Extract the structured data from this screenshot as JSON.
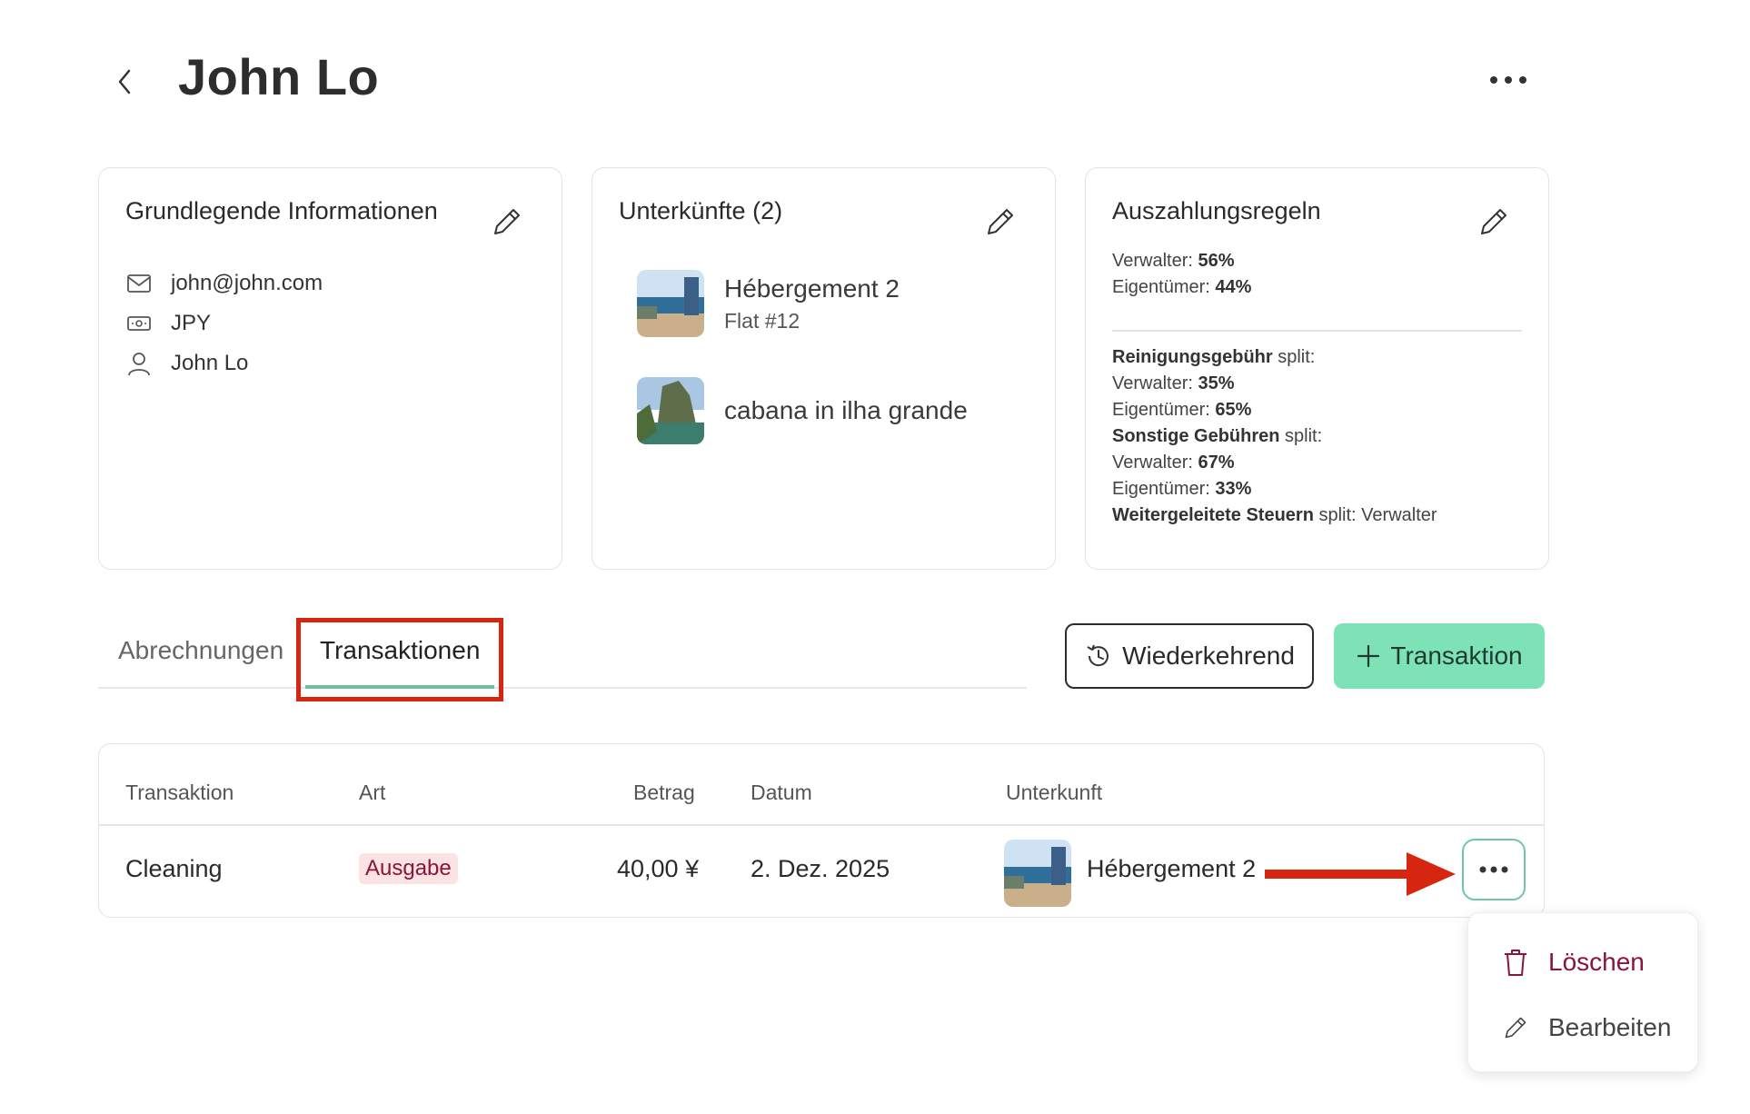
{
  "header": {
    "title": "John Lo"
  },
  "cards": {
    "basic": {
      "title": "Grundlegende Informationen",
      "email": "john@john.com",
      "currency": "JPY",
      "name": "John Lo"
    },
    "properties": {
      "title": "Unterkünfte (2)",
      "items": [
        {
          "name": "Hébergement 2",
          "sub": "Flat #12"
        },
        {
          "name": "cabana in ilha grande"
        }
      ]
    },
    "payout": {
      "title": "Auszahlungsregeln",
      "manager_label": "Verwalter: ",
      "manager_value": "56%",
      "owner_label": "Eigentümer: ",
      "owner_value": "44%",
      "cleaning_label": "Reinigungsgebühr",
      "split_suffix": " split:",
      "cleaning_manager_label": "Verwalter: ",
      "cleaning_manager_value": "35%",
      "cleaning_owner_label": "Eigentümer: ",
      "cleaning_owner_value": "65%",
      "other_label": "Sonstige Gebühren",
      "other_manager_label": "Verwalter: ",
      "other_manager_value": "67%",
      "other_owner_label": "Eigentümer: ",
      "other_owner_value": "33%",
      "tax_label": "Weitergeleitete Steuern",
      "tax_suffix": " split: Verwalter"
    }
  },
  "tabs": [
    {
      "label": "Abrechnungen",
      "active": false
    },
    {
      "label": "Transaktionen",
      "active": true
    }
  ],
  "actions": {
    "recurring_label": "Wiederkehrend",
    "add_transaction_label": "Transaktion"
  },
  "table": {
    "columns": [
      "Transaktion",
      "Art",
      "Betrag",
      "Datum",
      "Unterkunft"
    ],
    "rows": [
      {
        "transaction": "Cleaning",
        "type": "Ausgabe",
        "amount": "40,00 ¥",
        "date": "2. Dez. 2025",
        "property": "Hébergement 2"
      }
    ]
  },
  "menu": {
    "delete_label": "Löschen",
    "edit_label": "Bearbeiten"
  },
  "colors": {
    "accent": "#7ee2b7",
    "tab_underline": "#6fbfa3",
    "highlight_box": "#d7260f",
    "arrow": "#d7260f",
    "expense_badge_bg": "#fbe3e3",
    "expense_badge_text": "#8a1538"
  },
  "icons": [
    "chevron-left-icon",
    "more-horizontal-icon",
    "pencil-icon",
    "mail-icon",
    "currency-icon",
    "user-icon",
    "history-icon",
    "plus-icon",
    "trash-icon"
  ]
}
